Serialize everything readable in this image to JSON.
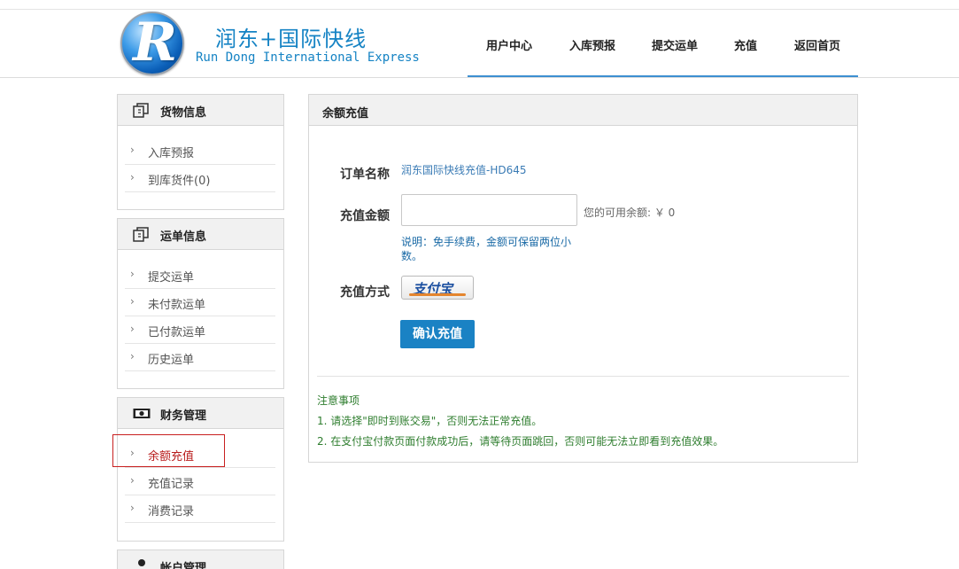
{
  "header": {
    "logo_letter": "R",
    "logo_cn": "润东+国际快线",
    "logo_en": "Run Dong International Express",
    "nav": [
      "用户中心",
      "入库预报",
      "提交运单",
      "充值",
      "返回首页"
    ],
    "accent_color": "#3d8fd1"
  },
  "sidebar": {
    "panels": [
      {
        "title": "货物信息",
        "icon": "copy-icon",
        "items": [
          "入库预报",
          "到库货件(0)"
        ]
      },
      {
        "title": "运单信息",
        "icon": "copy-icon",
        "items": [
          "提交运单",
          "未付款运单",
          "已付款运单",
          "历史运单"
        ]
      },
      {
        "title": "财务管理",
        "icon": "money-icon",
        "items": [
          "余额充值",
          "充值记录",
          "消费记录"
        ],
        "active_item": "余额充值"
      },
      {
        "title": "帐户管理",
        "icon": "user-icon",
        "items": []
      }
    ]
  },
  "main": {
    "title": "余额充值",
    "order_label": "订单名称",
    "order_value": "润东国际快线充值-HD645",
    "amount_label": "充值金额",
    "amount_value": "",
    "balance_text": "您的可用余额: ￥ 0",
    "note": "说明：免手续费，金额可保留两位小数。",
    "method_label": "充值方式",
    "method_value": "支付宝",
    "confirm_button": "确认充值",
    "notice_title": "注意事项",
    "notices": [
      "1. 请选择\"即时到账交易\"，否则无法正常充值。",
      "2. 在支付宝付款页面付款成功后，请等待页面跳回，否则可能无法立即看到充值效果。"
    ]
  }
}
